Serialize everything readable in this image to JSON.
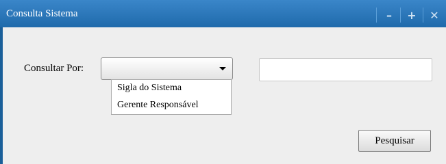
{
  "window": {
    "title": "Consulta Sistema",
    "buttons": {
      "minimize": "–",
      "maximize": "+",
      "close": "✕"
    },
    "accent": "#1f6aab"
  },
  "form": {
    "consult_label": "Consultar Por:",
    "select_value": "",
    "options": [
      "Sigla do Sistema",
      "Gerente Responsável"
    ],
    "search_value": "",
    "search_button": "Pesquisar"
  }
}
